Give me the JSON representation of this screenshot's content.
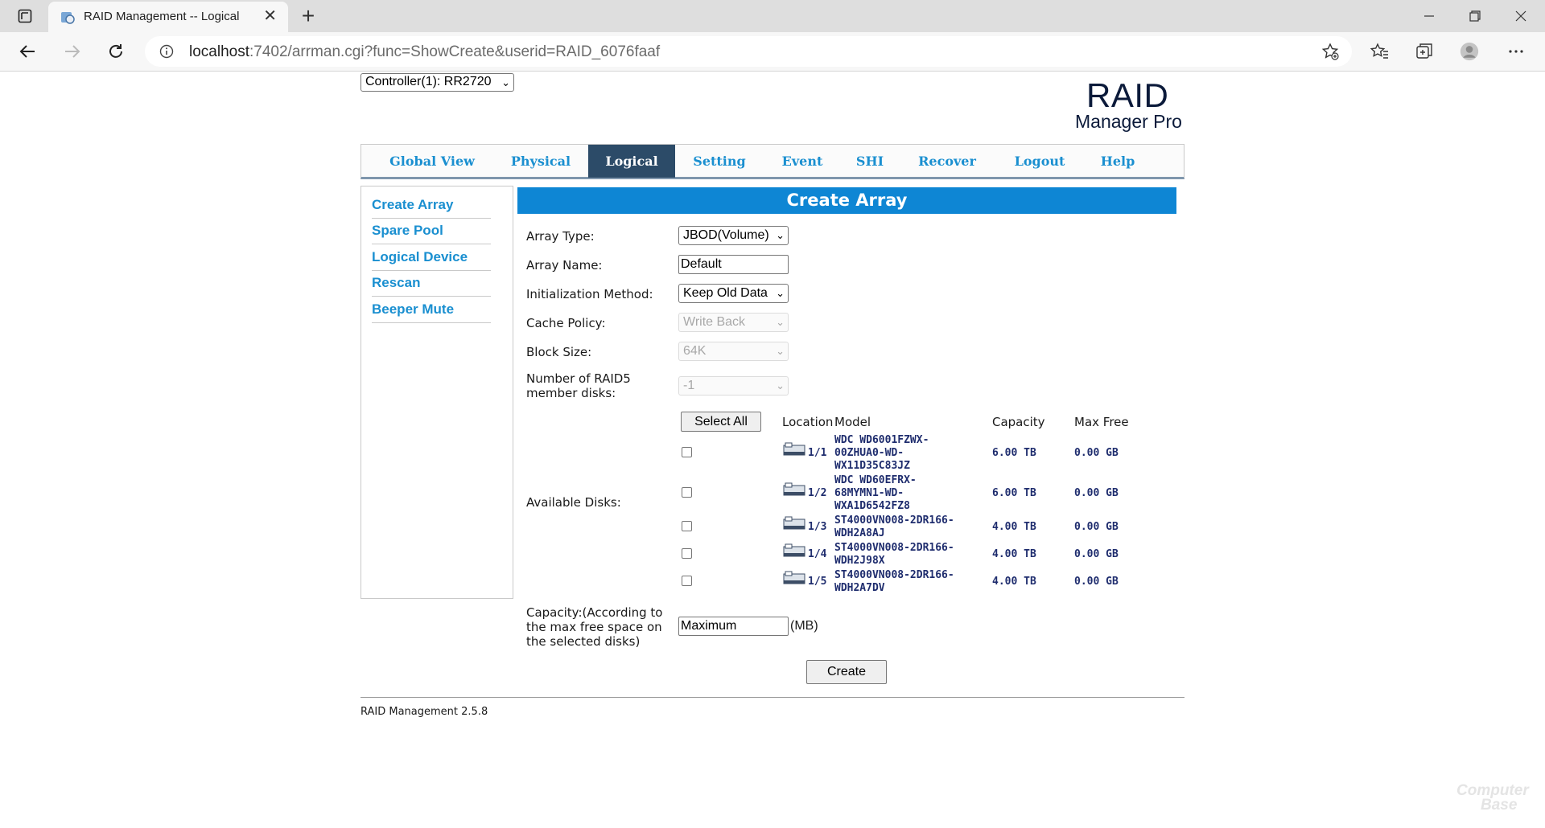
{
  "browser": {
    "tab_title": "RAID Management -- Logical",
    "url_host": "localhost",
    "url_rest": ":7402/arrman.cgi?func=ShowCreate&userid=RAID_6076faaf"
  },
  "page": {
    "controller_select": "Controller(1): RR2720",
    "logo_line1": "RAID",
    "logo_line2": "Manager Pro",
    "nav": [
      "Global View",
      "Physical",
      "Logical",
      "Setting",
      "Event",
      "SHI",
      "Recover",
      "Logout",
      "Help"
    ],
    "active_nav": "Logical",
    "sidebar": [
      "Create Array",
      "Spare Pool",
      "Logical Device",
      "Rescan",
      "Beeper Mute"
    ],
    "panel_title": "Create Array",
    "form": {
      "array_type_label": "Array Type:",
      "array_type_value": "JBOD(Volume)",
      "array_name_label": "Array Name:",
      "array_name_value": "Default",
      "init_label": "Initialization Method:",
      "init_value": "Keep Old Data",
      "cache_label": "Cache Policy:",
      "cache_value": "Write Back",
      "block_label": "Block Size:",
      "block_value": "64K",
      "raid5_label_1": "Number of RAID5",
      "raid5_label_2": "member disks:",
      "raid5_value": "-1",
      "available_label": "Available Disks:",
      "select_all": "Select All",
      "capacity_label_1": "Capacity:(According to",
      "capacity_label_2": "the max free space on",
      "capacity_label_3": "the selected disks)",
      "capacity_value": "Maximum",
      "capacity_unit": "(MB)",
      "create_button": "Create"
    },
    "disk_headers": {
      "location": "Location",
      "model": "Model",
      "capacity": "Capacity",
      "max_free": "Max Free"
    },
    "disks": [
      {
        "location": "1/1",
        "model": [
          "WDC WD6001FZWX-",
          "00ZHUA0-WD-",
          "WX11D35C83JZ"
        ],
        "capacity": "6.00 TB",
        "max_free": "0.00 GB"
      },
      {
        "location": "1/2",
        "model": [
          "WDC WD60EFRX-",
          "68MYMN1-WD-",
          "WXA1D6542FZ8"
        ],
        "capacity": "6.00 TB",
        "max_free": "0.00 GB"
      },
      {
        "location": "1/3",
        "model": [
          "ST4000VN008-2DR166-",
          "WDH2A8AJ"
        ],
        "capacity": "4.00 TB",
        "max_free": "0.00 GB"
      },
      {
        "location": "1/4",
        "model": [
          "ST4000VN008-2DR166-",
          "WDH2J98X"
        ],
        "capacity": "4.00 TB",
        "max_free": "0.00 GB"
      },
      {
        "location": "1/5",
        "model": [
          "ST4000VN008-2DR166-",
          "WDH2A7DV"
        ],
        "capacity": "4.00 TB",
        "max_free": "0.00 GB"
      }
    ],
    "footer": "RAID Management 2.5.8",
    "watermark": [
      "Computer",
      "Base"
    ]
  },
  "colors": {
    "link_blue": "#1a8fd0",
    "header_blue": "#0e86d4",
    "active_tab": "#2c4b68",
    "disk_text": "#1f2d6e"
  }
}
